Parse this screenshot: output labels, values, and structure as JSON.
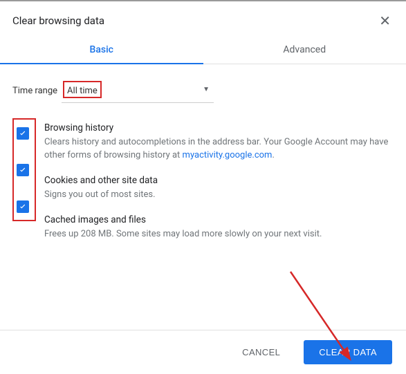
{
  "dialog": {
    "title": "Clear browsing data",
    "tabs": {
      "basic": "Basic",
      "advanced": "Advanced"
    },
    "time_range": {
      "label": "Time range",
      "value": "All time"
    },
    "options": [
      {
        "title": "Browsing history",
        "desc_1": "Clears history and autocompletions in the address bar. Your Google Account may have other forms of browsing history at ",
        "link": "myactivity.google.com",
        "desc_2": ".",
        "checked": true
      },
      {
        "title": "Cookies and other site data",
        "desc_1": "Signs you out of most sites.",
        "checked": true
      },
      {
        "title": "Cached images and files",
        "desc_1": "Frees up 208 MB. Some sites may load more slowly on your next visit.",
        "checked": true
      }
    ],
    "buttons": {
      "cancel": "CANCEL",
      "clear": "CLEAR DATA"
    }
  }
}
